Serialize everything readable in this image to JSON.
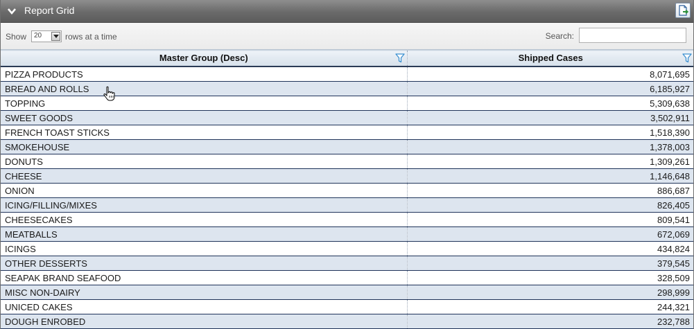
{
  "panel": {
    "title": "Report Grid",
    "collapse_icon": "chevron-down-icon",
    "export_icon": "export-icon"
  },
  "toolbar": {
    "show_label": "Show",
    "rows_value": "20",
    "rows_label": "rows at a time",
    "search_label": "Search:",
    "search_value": ""
  },
  "grid": {
    "columns": [
      {
        "label": "Master Group (Desc)",
        "filter_icon": "filter-icon"
      },
      {
        "label": "Shipped Cases",
        "filter_icon": "filter-icon"
      }
    ],
    "rows": [
      {
        "group": "PIZZA PRODUCTS",
        "cases": "8,071,695"
      },
      {
        "group": "BREAD AND ROLLS",
        "cases": "6,185,927"
      },
      {
        "group": "TOPPING",
        "cases": "5,309,638"
      },
      {
        "group": "SWEET GOODS",
        "cases": "3,502,911"
      },
      {
        "group": "FRENCH TOAST STICKS",
        "cases": "1,518,390"
      },
      {
        "group": "SMOKEHOUSE",
        "cases": "1,378,003"
      },
      {
        "group": "DONUTS",
        "cases": "1,309,261"
      },
      {
        "group": "CHEESE",
        "cases": "1,146,648"
      },
      {
        "group": "ONION",
        "cases": "886,687"
      },
      {
        "group": "ICING/FILLING/MIXES",
        "cases": "826,405"
      },
      {
        "group": "CHEESECAKES",
        "cases": "809,541"
      },
      {
        "group": "MEATBALLS",
        "cases": "672,069"
      },
      {
        "group": "ICINGS",
        "cases": "434,824"
      },
      {
        "group": "OTHER DESSERTS",
        "cases": "379,545"
      },
      {
        "group": "SEAPAK BRAND SEAFOOD",
        "cases": "328,509"
      },
      {
        "group": "MISC NON-DAIRY",
        "cases": "298,999"
      },
      {
        "group": "UNICED CAKES",
        "cases": "244,321"
      },
      {
        "group": "DOUGH ENROBED",
        "cases": "232,788"
      }
    ]
  },
  "colors": {
    "title_bar": "#6a6a6a",
    "row_alt": "#dde5ef",
    "row_border": "#1f3359",
    "filter_icon": "#3a8fd0"
  }
}
